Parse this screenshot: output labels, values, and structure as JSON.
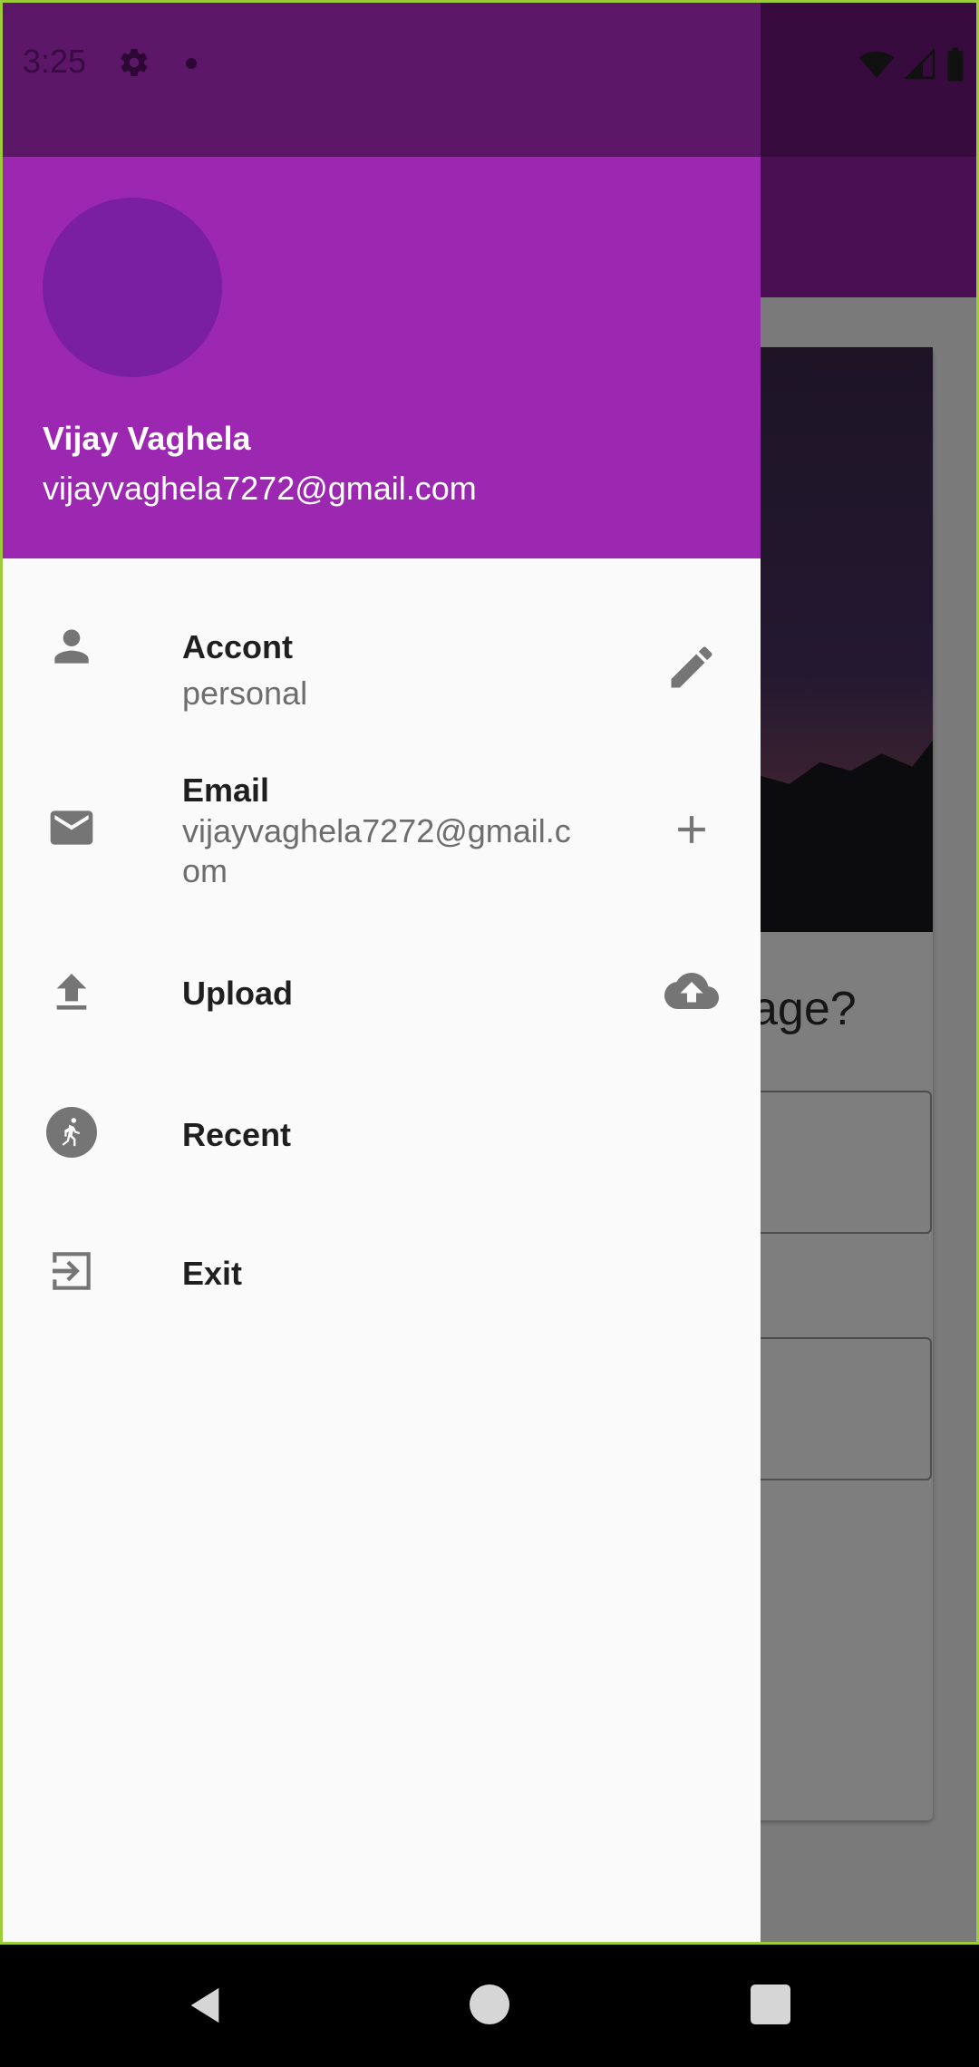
{
  "status_bar": {
    "time": "3:25"
  },
  "background_app": {
    "question_fragment": "age?"
  },
  "drawer": {
    "header": {
      "name": "Vijay Vaghela",
      "email": "vijayvaghela7272@gmail.com"
    },
    "items": [
      {
        "title": "Accont",
        "subtitle": "personal",
        "icon": "person-icon",
        "trailing_icon": "edit-pencil-icon"
      },
      {
        "title": "Email",
        "subtitle": "vijayvaghela7272@gmail.com",
        "icon": "mail-icon",
        "trailing_icon": "add-plus-icon"
      },
      {
        "title": "Upload",
        "icon": "upload-icon",
        "trailing_icon": "cloud-upload-icon"
      },
      {
        "title": "Recent",
        "icon": "directions-run-icon"
      },
      {
        "title": "Exit",
        "icon": "exit-icon"
      }
    ]
  },
  "colors": {
    "header_purple": "#9c27b0",
    "avatar_purple": "#7b1fa2",
    "icon_grey": "#757575"
  }
}
